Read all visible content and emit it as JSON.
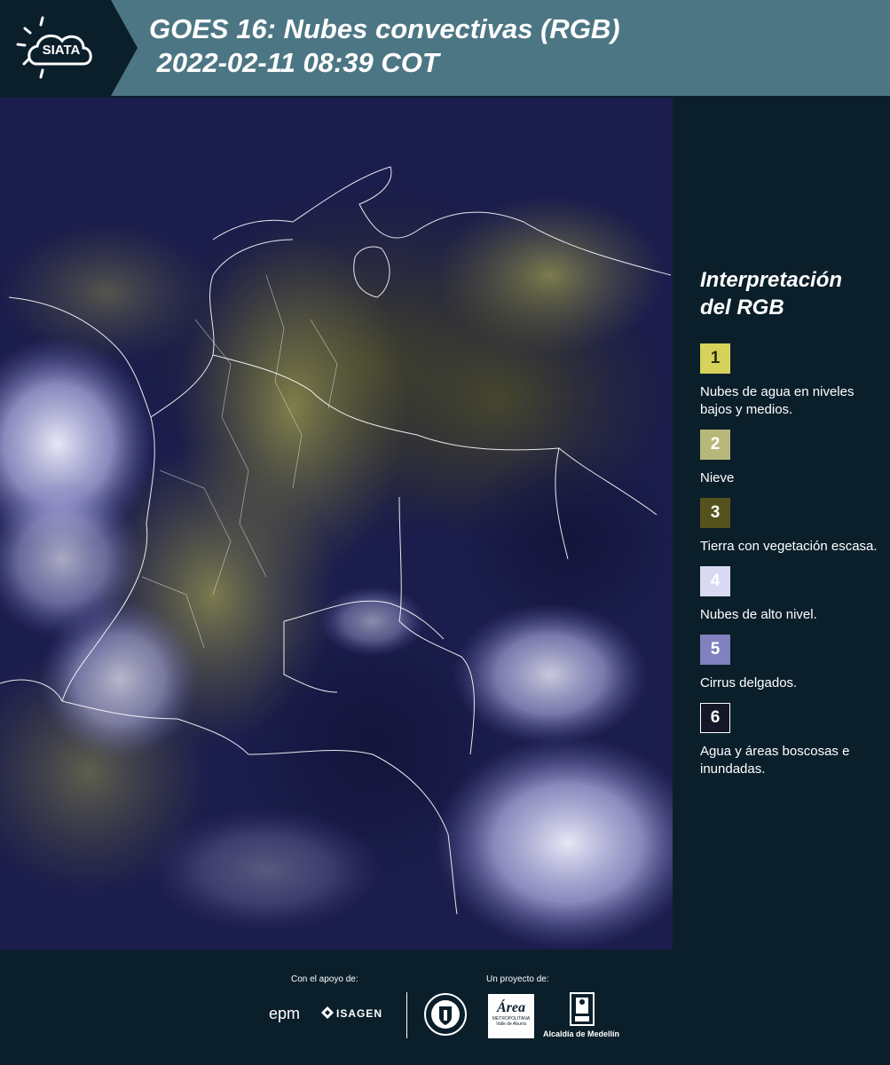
{
  "header": {
    "logo_text": "SIATA",
    "title_line1": "GOES 16: Nubes convectivas (RGB)",
    "title_line2": " 2022-02-11 08:39 COT"
  },
  "legend": {
    "title_line1": "Interpretación",
    "title_line2": "del RGB",
    "items": [
      {
        "number": "1",
        "color": "#d7d35a",
        "text_color": "#2a2a10",
        "label": "Nubes de agua en niveles bajos y medios."
      },
      {
        "number": "2",
        "color": "#b8b77a",
        "text_color": "#ffffff",
        "label": "Nieve"
      },
      {
        "number": "3",
        "color": "#55521e",
        "text_color": "#ffffff",
        "label": "Tierra con vegetación escasa."
      },
      {
        "number": "4",
        "color": "#d9d9f2",
        "text_color": "#ffffff",
        "label": "Nubes de alto nivel."
      },
      {
        "number": "5",
        "color": "#8181c0",
        "text_color": "#ffffff",
        "label": "Cirrus delgados."
      },
      {
        "number": "6",
        "color": "#151628",
        "text_color": "#ffffff",
        "label": "Agua y áreas boscosas e inundadas."
      }
    ]
  },
  "footer": {
    "support_label": "Con el apoyo de:",
    "project_label": "Un proyecto de:",
    "sponsors": {
      "epm": "epm",
      "isagen": "ISAGEN",
      "area_name": "Área",
      "area_sub1": "METROPOLITANA",
      "area_sub2": "Valle de Aburrá",
      "alcaldia": "Alcaldía de Medellín"
    }
  }
}
